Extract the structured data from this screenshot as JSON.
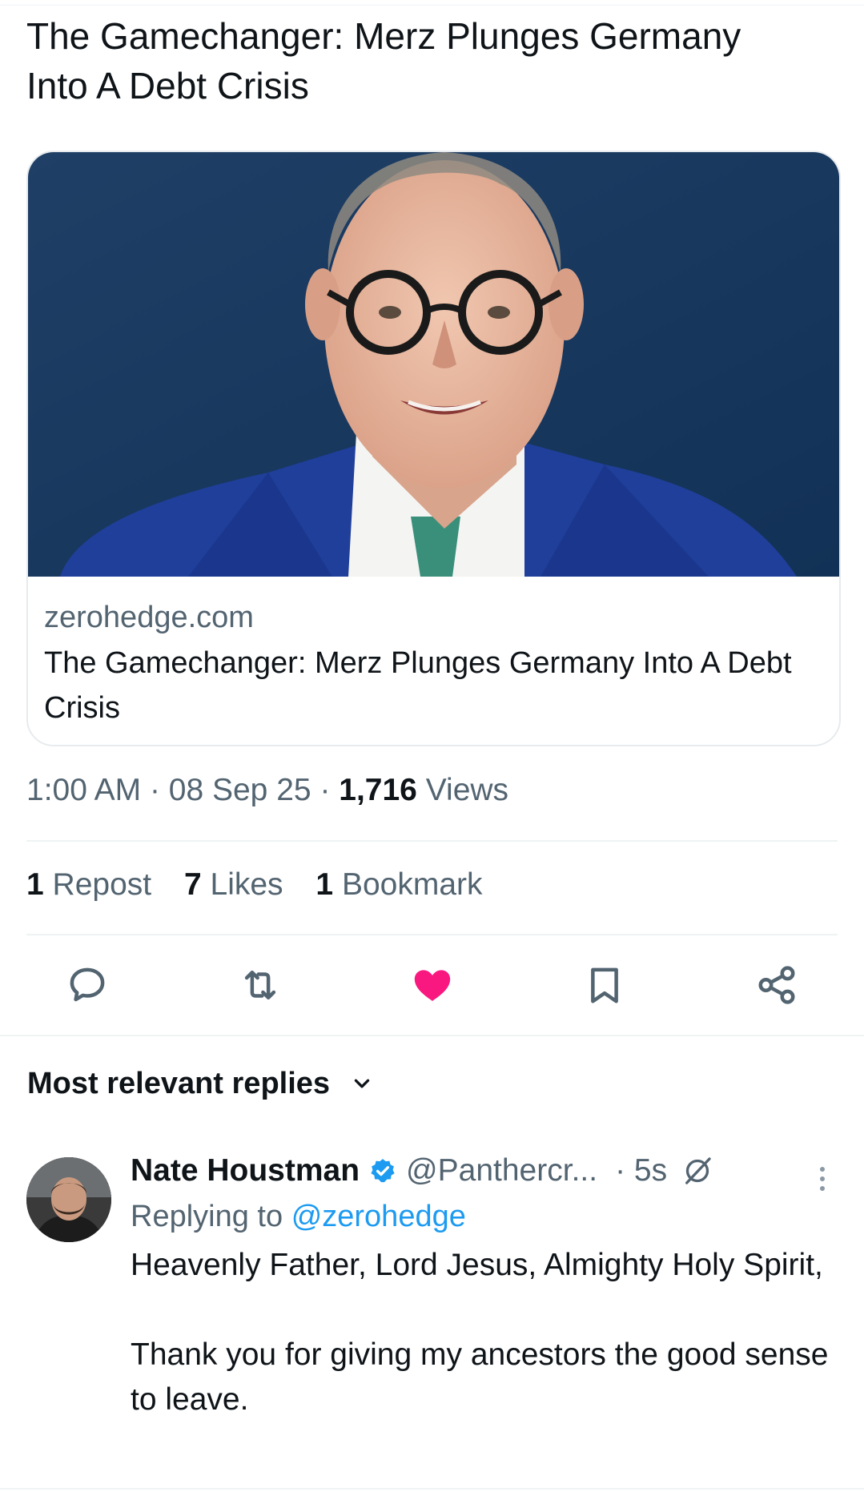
{
  "tweet": {
    "text": "The Gamechanger: Merz Plunges Germany\nInto A Debt Crisis",
    "card": {
      "domain": "zerohedge.com",
      "title": "The Gamechanger: Merz Plunges Germany Into A Debt Crisis"
    },
    "meta": {
      "time": "1:00 AM",
      "date": "08 Sep 25",
      "views_count": "1,716",
      "views_label": "Views"
    },
    "stats": {
      "reposts_count": "1",
      "reposts_label": "Repost",
      "likes_count": "7",
      "likes_label": "Likes",
      "bookmarks_count": "1",
      "bookmarks_label": "Bookmark"
    },
    "actions": {
      "reply_icon": "speech-bubble-icon",
      "repost_icon": "repost-arrows-icon",
      "like_icon": "heart-filled-icon",
      "bookmark_icon": "bookmark-icon",
      "share_icon": "share-nodes-icon",
      "like_color": "#f91880"
    }
  },
  "replies": {
    "header": "Most relevant replies",
    "items": [
      {
        "name": "Nate Houstman",
        "handle": "@Panthercr...",
        "time": "5s",
        "replying_prefix": "Replying to",
        "replying_handle": "@zerohedge",
        "text": "Heavenly Father, Lord Jesus, Almighty Holy Spirit,\n\nThank you for giving my ancestors the good sense to leave."
      }
    ]
  },
  "colors": {
    "text_primary": "#0f1419",
    "text_secondary": "#536471",
    "link": "#1d9bf0",
    "verified": "#1d9bf0",
    "border": "#eff3f4"
  }
}
